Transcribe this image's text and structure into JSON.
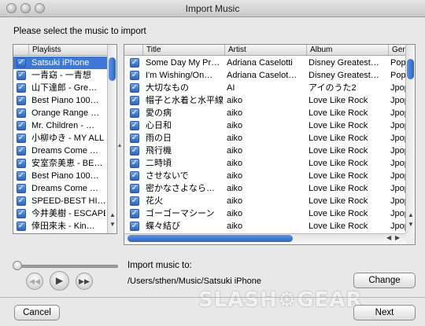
{
  "window": {
    "title": "Import Music"
  },
  "instruction": "Please select the music to import",
  "playlists": {
    "header": "Playlists",
    "items": [
      {
        "label": "Satsuki iPhone",
        "checked": true,
        "selected": true
      },
      {
        "label": "一青窈 - 一青想",
        "checked": true
      },
      {
        "label": "山下達郎 - Gre…",
        "checked": true
      },
      {
        "label": "Best Piano 100…",
        "checked": true
      },
      {
        "label": "Orange Range …",
        "checked": true
      },
      {
        "label": "Mr. Children - …",
        "checked": true
      },
      {
        "label": "小柳ゆき - MY ALL",
        "checked": true
      },
      {
        "label": "Dreams Come …",
        "checked": true
      },
      {
        "label": "安室奈美恵 - BE…",
        "checked": true
      },
      {
        "label": "Best Piano 100…",
        "checked": true
      },
      {
        "label": "Dreams Come …",
        "checked": true
      },
      {
        "label": "SPEED-BEST HI…",
        "checked": true
      },
      {
        "label": "今井美樹 - ESCAPE",
        "checked": true
      },
      {
        "label": "倖田來未 - Kin…",
        "checked": true
      }
    ]
  },
  "tracks": {
    "columns": [
      "Title",
      "Artist",
      "Album",
      "Genr"
    ],
    "rows": [
      {
        "title": "Some Day My Pr…",
        "artist": "Adriana Caselotti",
        "album": "Disney Greatest…",
        "genre": "Pop"
      },
      {
        "title": "I'm Wishing/On…",
        "artist": "Adriana Caselot…",
        "album": "Disney Greatest…",
        "genre": "Pop"
      },
      {
        "title": "大切なもの",
        "artist": "AI",
        "album": "アイのうた2",
        "genre": "Jpop"
      },
      {
        "title": "帽子と水着と水平線",
        "artist": "aiko",
        "album": "Love Like Rock",
        "genre": "Jpop"
      },
      {
        "title": "愛の病",
        "artist": "aiko",
        "album": "Love Like Rock",
        "genre": "Jpop"
      },
      {
        "title": "心日和",
        "artist": "aiko",
        "album": "Love Like Rock",
        "genre": "Jpop"
      },
      {
        "title": "雨の日",
        "artist": "aiko",
        "album": "Love Like Rock",
        "genre": "Jpop"
      },
      {
        "title": "飛行機",
        "artist": "aiko",
        "album": "Love Like Rock",
        "genre": "Jpop"
      },
      {
        "title": "二時頃",
        "artist": "aiko",
        "album": "Love Like Rock",
        "genre": "Jpop"
      },
      {
        "title": "させないで",
        "artist": "aiko",
        "album": "Love Like Rock",
        "genre": "Jpop"
      },
      {
        "title": "密かなさよなら…",
        "artist": "aiko",
        "album": "Love Like Rock",
        "genre": "Jpop"
      },
      {
        "title": "花火",
        "artist": "aiko",
        "album": "Love Like Rock",
        "genre": "Jpop"
      },
      {
        "title": "ゴーゴーマシーン",
        "artist": "aiko",
        "album": "Love Like Rock",
        "genre": "Jpop"
      },
      {
        "title": "蝶々結び",
        "artist": "aiko",
        "album": "Love Like Rock",
        "genre": "Jpop"
      }
    ]
  },
  "import": {
    "label": "Import music to:",
    "path": "/Users/sthen/Music/Satsuki iPhone",
    "change_label": "Change"
  },
  "player": {
    "rewind_icon": "rewind-icon",
    "play_icon": "play-icon",
    "forward_icon": "fast-forward-icon"
  },
  "footer": {
    "cancel_label": "Cancel",
    "next_label": "Next"
  },
  "watermark": "SLASHGEAR",
  "colors": {
    "selection": "#3b78d8",
    "checkbox": "#2866c8",
    "window_bg": "#e8e8e8"
  }
}
